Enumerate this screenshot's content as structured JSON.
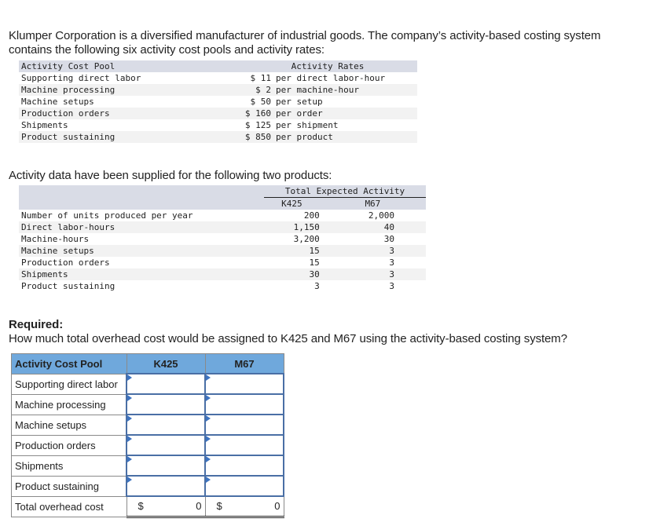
{
  "intro": "Klumper Corporation is a diversified manufacturer of industrial goods. The company’s activity-based costing system contains the following six activity cost pools and activity rates:",
  "rates_table": {
    "header_pool": "Activity Cost Pool",
    "header_rates": "Activity Rates",
    "rows": [
      {
        "pool": "Supporting direct labor",
        "amount": "$ 11",
        "unit": "per direct labor-hour"
      },
      {
        "pool": "Machine processing",
        "amount": "$ 2",
        "unit": "per machine-hour"
      },
      {
        "pool": "Machine setups",
        "amount": "$ 50",
        "unit": "per setup"
      },
      {
        "pool": "Production orders",
        "amount": "$ 160",
        "unit": "per order"
      },
      {
        "pool": "Shipments",
        "amount": "$ 125",
        "unit": "per shipment"
      },
      {
        "pool": "Product sustaining",
        "amount": "$ 850",
        "unit": "per product"
      }
    ]
  },
  "activity_intro": "Activity data have been supplied for the following two products:",
  "activity_table": {
    "group_header": "Total Expected Activity",
    "col_k": "K425",
    "col_m": "M67",
    "rows": [
      {
        "label": "Number of units produced per year",
        "k": "200",
        "m": "2,000"
      },
      {
        "label": "Direct labor-hours",
        "k": "1,150",
        "m": "40"
      },
      {
        "label": "Machine-hours",
        "k": "3,200",
        "m": "30"
      },
      {
        "label": "Machine setups",
        "k": "15",
        "m": "3"
      },
      {
        "label": "Production orders",
        "k": "15",
        "m": "3"
      },
      {
        "label": "Shipments",
        "k": "30",
        "m": "3"
      },
      {
        "label": "Product sustaining",
        "k": "3",
        "m": "3"
      }
    ]
  },
  "required": {
    "title": "Required:",
    "question": "How much total overhead cost would be assigned to K425 and M67 using the activity-based costing system?"
  },
  "answer_grid": {
    "header_pool": "Activity Cost Pool",
    "header_k": "K425",
    "header_m": "M67",
    "rows": [
      {
        "label": "Supporting direct labor",
        "k_value": "",
        "m_value": ""
      },
      {
        "label": "Machine processing",
        "k_value": "",
        "m_value": ""
      },
      {
        "label": "Machine setups",
        "k_value": "",
        "m_value": ""
      },
      {
        "label": "Production orders",
        "k_value": "",
        "m_value": ""
      },
      {
        "label": "Shipments",
        "k_value": "",
        "m_value": ""
      },
      {
        "label": "Product sustaining",
        "k_value": "",
        "m_value": ""
      }
    ],
    "total_label": "Total overhead cost",
    "currency": "$",
    "total_k": "0",
    "total_m": "0"
  }
}
